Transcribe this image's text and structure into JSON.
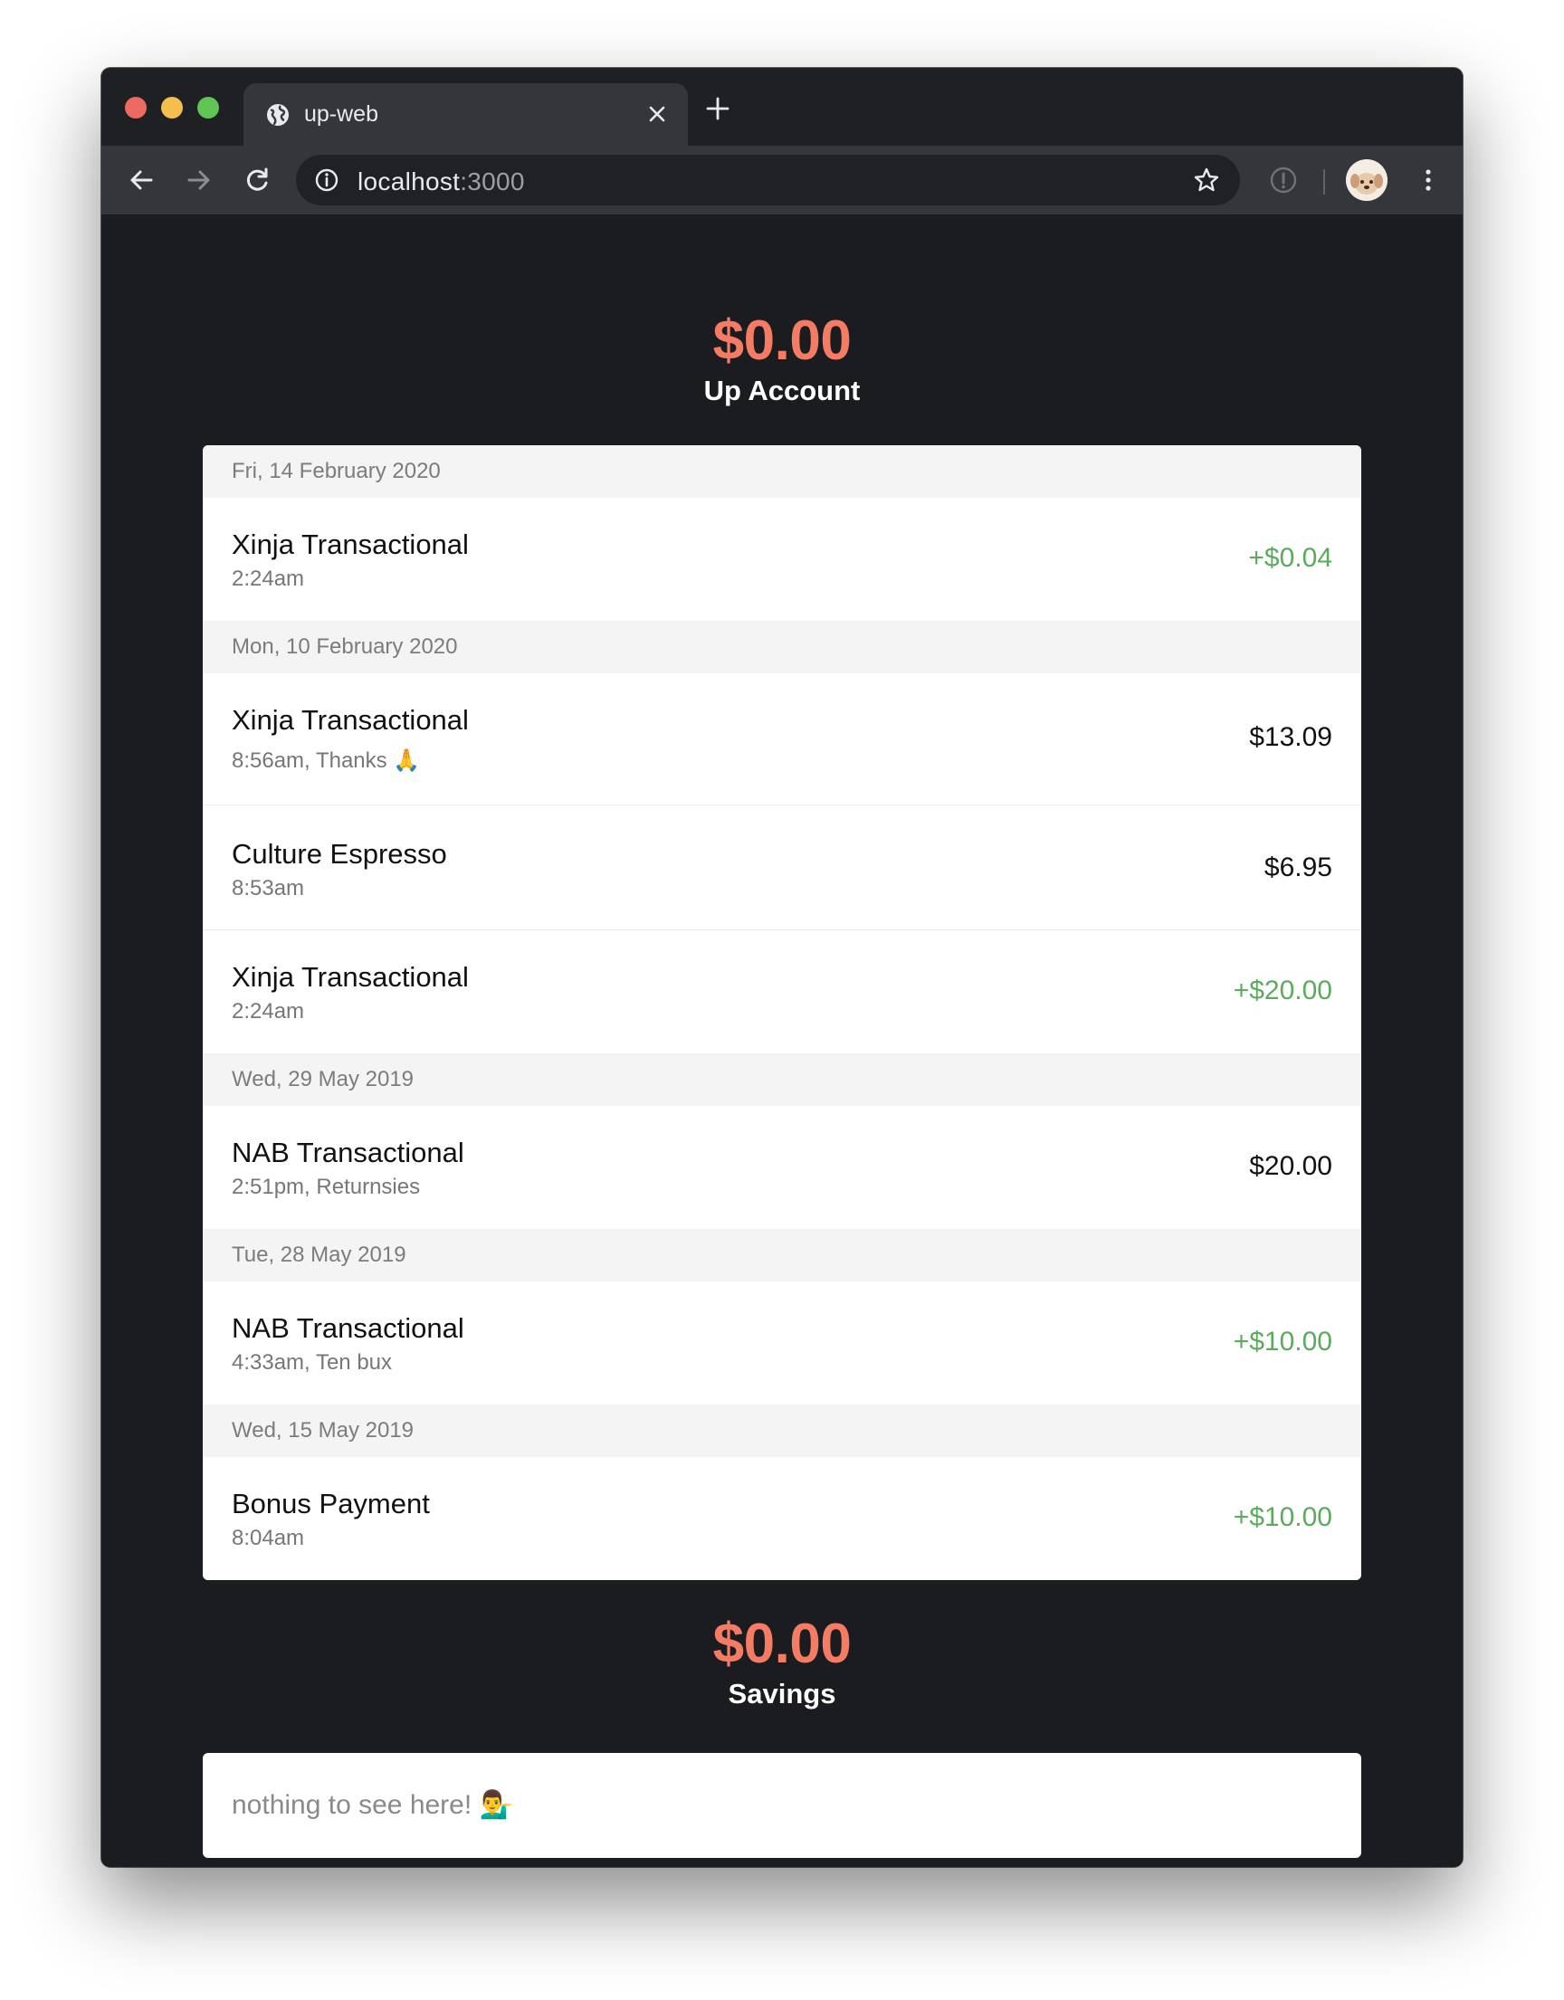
{
  "browser": {
    "tab_title": "up-web",
    "url_host": "localhost",
    "url_port": ":3000"
  },
  "up_account": {
    "balance": "$0.00",
    "name": "Up Account",
    "groups": [
      {
        "date": "Fri, 14 February 2020",
        "transactions": [
          {
            "description": "Xinja Transactional",
            "meta": "2:24am",
            "amount": "+$0.04",
            "type": "credit"
          }
        ]
      },
      {
        "date": "Mon, 10 February 2020",
        "transactions": [
          {
            "description": "Xinja Transactional",
            "meta": "8:56am, Thanks 🙏",
            "amount": "$13.09",
            "type": "debit"
          },
          {
            "description": "Culture Espresso",
            "meta": "8:53am",
            "amount": "$6.95",
            "type": "debit"
          },
          {
            "description": "Xinja Transactional",
            "meta": "2:24am",
            "amount": "+$20.00",
            "type": "credit"
          }
        ]
      },
      {
        "date": "Wed, 29 May 2019",
        "transactions": [
          {
            "description": "NAB Transactional",
            "meta": "2:51pm, Returnsies",
            "amount": "$20.00",
            "type": "debit"
          }
        ]
      },
      {
        "date": "Tue, 28 May 2019",
        "transactions": [
          {
            "description": "NAB Transactional",
            "meta": "4:33am, Ten bux",
            "amount": "+$10.00",
            "type": "credit"
          }
        ]
      },
      {
        "date": "Wed, 15 May 2019",
        "transactions": [
          {
            "description": "Bonus Payment",
            "meta": "8:04am",
            "amount": "+$10.00",
            "type": "credit"
          }
        ]
      }
    ]
  },
  "savings": {
    "balance": "$0.00",
    "name": "Savings",
    "empty_message": "nothing to see here! 💁‍♂️"
  },
  "colors": {
    "balance_accent": "#f47c64",
    "credit": "#5cab5d",
    "debit": "#111111",
    "page_background": "#1b1c20"
  },
  "icons": [
    "globe-icon",
    "close-icon",
    "plus-icon",
    "back-arrow-icon",
    "forward-arrow-icon",
    "reload-icon",
    "info-icon",
    "star-icon",
    "extension-icon",
    "avatar",
    "more-vert-icon"
  ]
}
